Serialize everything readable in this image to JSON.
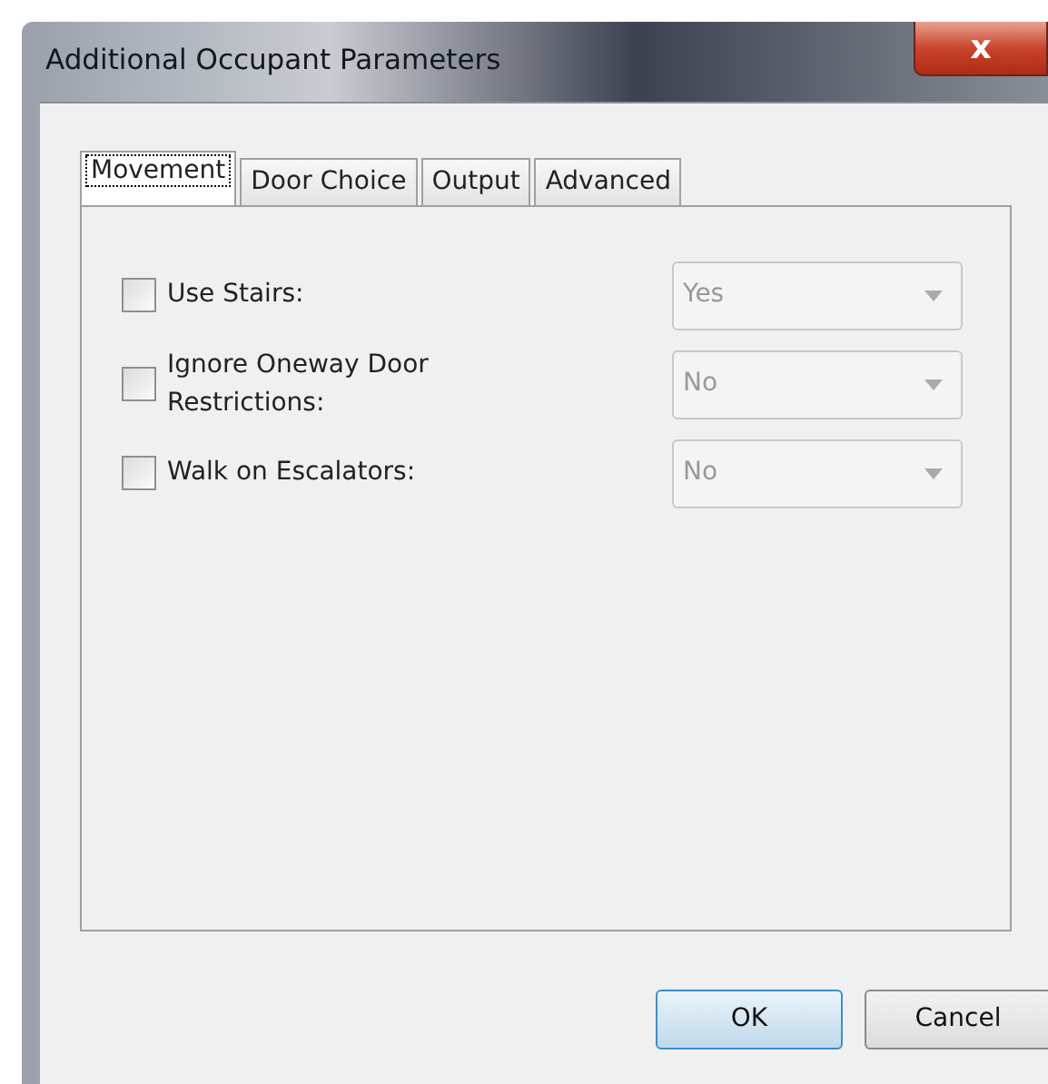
{
  "window": {
    "title": "Additional Occupant Parameters",
    "close": "x"
  },
  "tabs": [
    {
      "label": "Movement",
      "selected": true
    },
    {
      "label": "Door Choice",
      "selected": false
    },
    {
      "label": "Output",
      "selected": false
    },
    {
      "label": "Advanced",
      "selected": false
    }
  ],
  "options": [
    {
      "label": "Use Stairs:",
      "checked": false,
      "value": "Yes",
      "disabled": true
    },
    {
      "label": "Ignore Oneway Door Restrictions:",
      "checked": false,
      "value": "No",
      "disabled": true
    },
    {
      "label": "Walk on Escalators:",
      "checked": false,
      "value": "No",
      "disabled": true
    }
  ],
  "buttons": [
    {
      "label": "OK",
      "default": true
    },
    {
      "label": "Cancel",
      "default": false
    }
  ]
}
